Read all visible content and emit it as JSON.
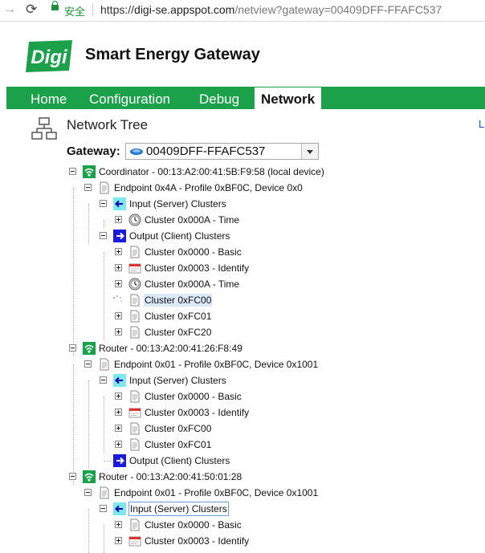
{
  "browser": {
    "secure_label": "安全",
    "url_scheme": "https://",
    "url_host": "digi-se.appspot.com",
    "url_path": "/netview?gateway=00409DFF-FFAFC537"
  },
  "header": {
    "logo_text": "Digi",
    "app_title": "Smart Energy Gateway"
  },
  "nav": {
    "items": [
      "Home",
      "Configuration",
      "Debug",
      "Network"
    ],
    "active": "Network"
  },
  "page": {
    "title": "Network Tree",
    "right_link": "L"
  },
  "gateway": {
    "label": "Gateway:",
    "selected": "00409DFF-FFAFC537"
  },
  "tree": [
    {
      "text": "Coordinator - 00:13:A2:00:41:5B:F9:58 (local device)",
      "icon": "wifi-signal-icon",
      "toggle": "minus"
    },
    {
      "text": "Endpoint 0x4A - Profile 0xBF0C, Device 0x0",
      "icon": "document-icon",
      "toggle": "minus"
    },
    {
      "text": "Input (Server) Clusters",
      "icon": "arrow-left-icon",
      "toggle": "minus"
    },
    {
      "text": "Cluster 0x000A - Time",
      "icon": "clock-icon",
      "toggle": "plus"
    },
    {
      "text": "Output (Client) Clusters",
      "icon": "arrow-right-icon",
      "toggle": "minus"
    },
    {
      "text": "Cluster 0x0000 - Basic",
      "icon": "document-icon",
      "toggle": "plus"
    },
    {
      "text": "Cluster 0x0003 - Identify",
      "icon": "identify-card-icon",
      "toggle": "plus"
    },
    {
      "text": "Cluster 0x000A - Time",
      "icon": "clock-icon",
      "toggle": "plus"
    },
    {
      "text": "Cluster 0xFC00",
      "icon": "document-icon",
      "toggle": "loading"
    },
    {
      "text": "Cluster 0xFC01",
      "icon": "document-icon",
      "toggle": "plus"
    },
    {
      "text": "Cluster 0xFC20",
      "icon": "document-icon",
      "toggle": "plus"
    },
    {
      "text": "Router - 00:13:A2:00:41:26:F8:49",
      "icon": "wifi-signal-icon",
      "toggle": "minus"
    },
    {
      "text": "Endpoint 0x01 - Profile 0xBF0C, Device 0x1001",
      "icon": "document-icon",
      "toggle": "minus"
    },
    {
      "text": "Input (Server) Clusters",
      "icon": "arrow-left-icon",
      "toggle": "minus"
    },
    {
      "text": "Cluster 0x0000 - Basic",
      "icon": "document-icon",
      "toggle": "plus"
    },
    {
      "text": "Cluster 0x0003 - Identify",
      "icon": "identify-card-icon",
      "toggle": "plus"
    },
    {
      "text": "Cluster 0xFC00",
      "icon": "document-icon",
      "toggle": "plus"
    },
    {
      "text": "Cluster 0xFC01",
      "icon": "document-icon",
      "toggle": "plus"
    },
    {
      "text": "Output (Client) Clusters",
      "icon": "arrow-right-icon",
      "toggle": "none"
    },
    {
      "text": "Router - 00:13:A2:00:41:50:01:28",
      "icon": "wifi-signal-icon",
      "toggle": "minus"
    },
    {
      "text": "Endpoint 0x01 - Profile 0xBF0C, Device 0x1001",
      "icon": "document-icon",
      "toggle": "minus"
    },
    {
      "text": "Input (Server) Clusters",
      "icon": "arrow-left-icon",
      "toggle": "minus"
    },
    {
      "text": "Cluster 0x0000 - Basic",
      "icon": "document-icon",
      "toggle": "plus"
    },
    {
      "text": "Cluster 0x0003 - Identify",
      "icon": "identify-card-icon",
      "toggle": "plus"
    }
  ],
  "selection": {
    "selected_label": "Cluster 0xFC00",
    "focused_label": "Input (Server) Clusters"
  },
  "colors": {
    "nav_green": "#1aa14a",
    "logo_green": "#1aa14a",
    "link_blue": "#1a56c8",
    "arrow_blue": "#1a1adf",
    "arrow_cyan": "#7fe7f0"
  }
}
